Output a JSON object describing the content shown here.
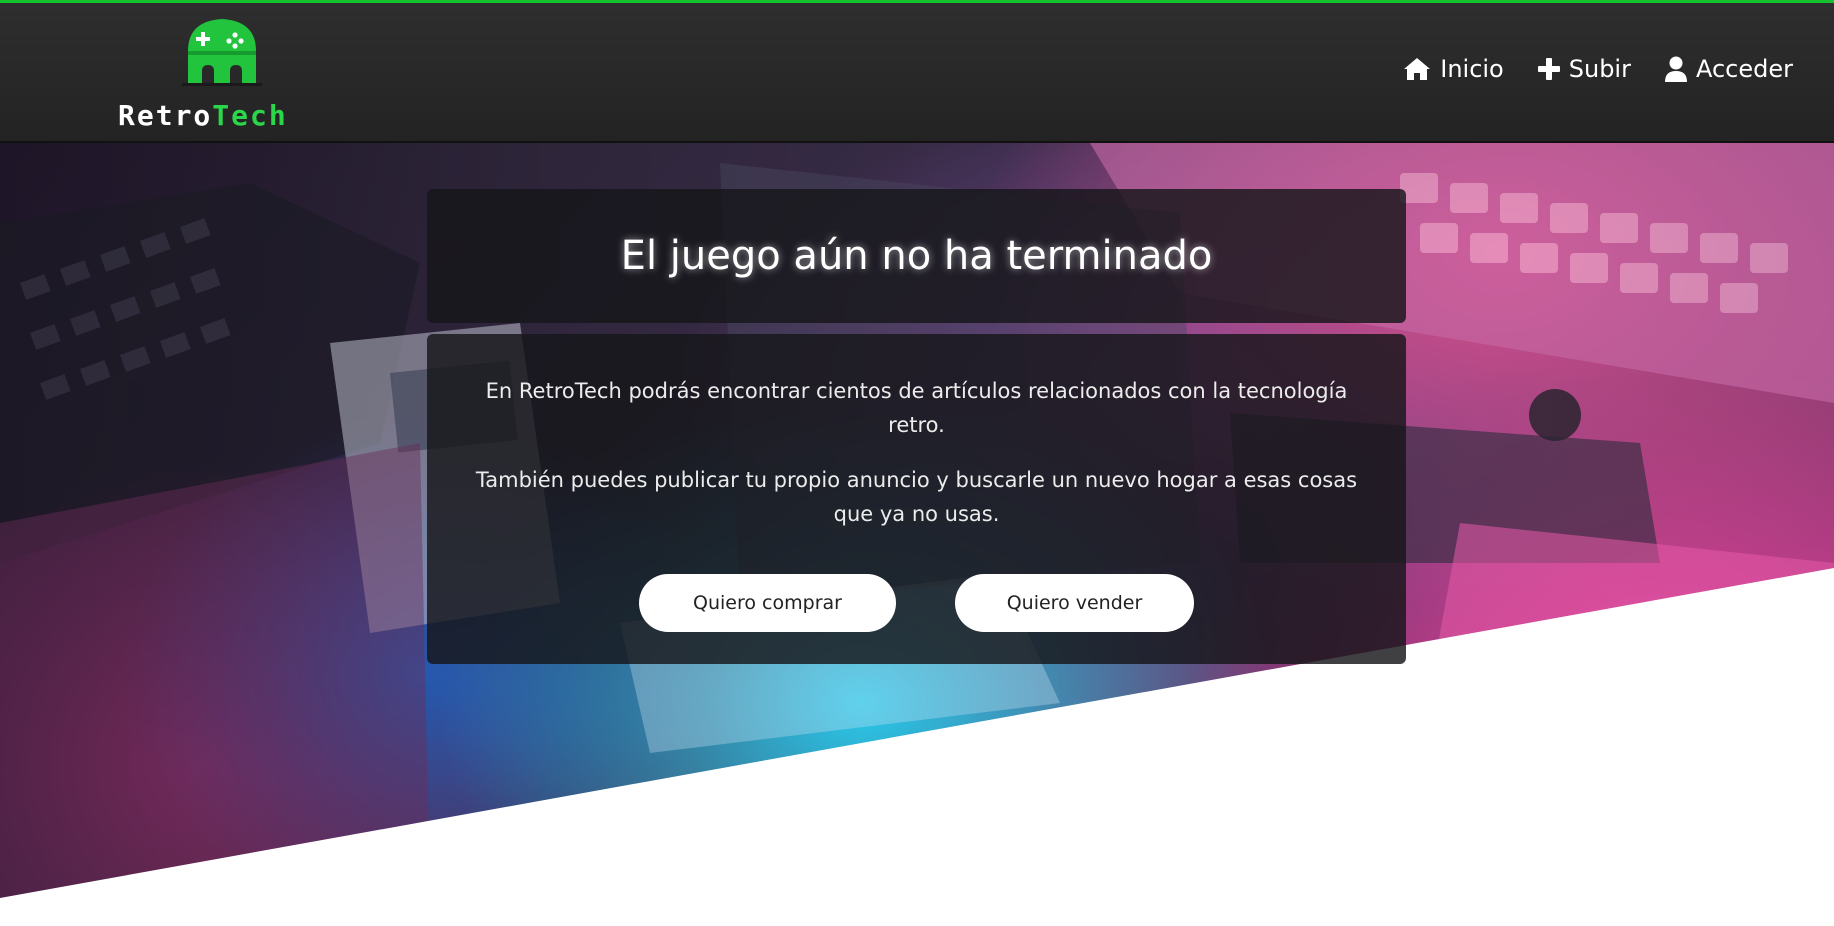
{
  "brand": {
    "name_part1": "Retro",
    "name_part2": "Tech",
    "logo_icon": "gamepad-castle-icon"
  },
  "nav": {
    "items": [
      {
        "label": "Inicio",
        "icon": "home-icon"
      },
      {
        "label": "Subir",
        "icon": "plus-icon"
      },
      {
        "label": "Acceder",
        "icon": "user-icon"
      }
    ]
  },
  "hero": {
    "title": "El juego aún no ha terminado",
    "paragraph1": "En RetroTech podrás encontrar cientos de artículos relacionados con la tecnología retro.",
    "paragraph2": "También puedes publicar tu propio anuncio y buscarle un nuevo hogar a esas cosas que ya no usas.",
    "buy_label": "Quiero comprar",
    "sell_label": "Quiero vender",
    "background_icon": "retro-computers-photo"
  },
  "colors": {
    "accent": "#16c12e",
    "brand_green": "#2bd64a",
    "navbar": "#2a2a2a",
    "card": "#16161a",
    "button": "#ffffff"
  }
}
